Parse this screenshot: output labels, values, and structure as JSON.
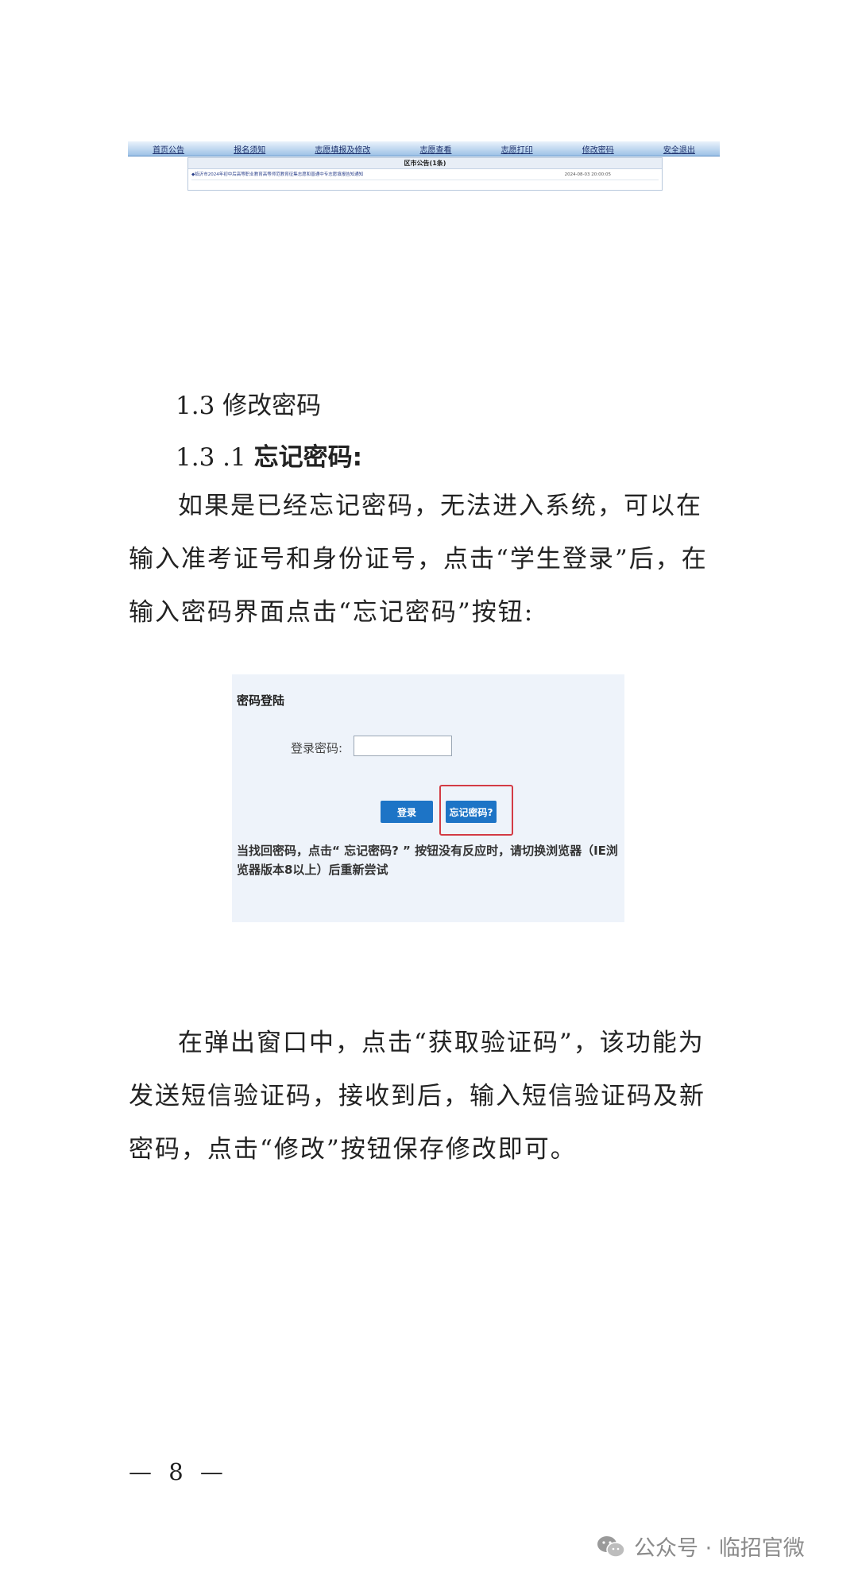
{
  "nav_screenshot": {
    "items": [
      "首页公告",
      "报名须知",
      "志愿填报及修改",
      "志愿查看",
      "志愿打印",
      "修改密码",
      "安全退出"
    ],
    "notice_title": "区市公告(1条)",
    "notice_text": "◆临沂市2024年初中后高等职业教育高等师范教育征集志愿和普通中专志愿填报告知通知",
    "notice_date": "2024-08-03 20:00:05"
  },
  "heading_13": "1.3 修改密码",
  "heading_131_num": "1.3 .1 ",
  "heading_131_title": "忘记密码:",
  "paragraph_1": "如果是已经忘记密码，无法进入系统，可以在输入准考证号和身份证号，点击“学生登录”后，在输入密码界面点击“忘记密码”按钮:",
  "login_screenshot": {
    "title": "密码登陆",
    "password_label": "登录密码:",
    "login_button": "登录",
    "forgot_button": "忘记密码?",
    "tip": "当找回密码，点击“ 忘记密码? ” 按钮没有反应时，请切换浏览器（IE浏览器版本8以上）后重新尝试",
    "highlight_color": "#d33b45",
    "button_color": "#1d74c6"
  },
  "paragraph_2": "在弹出窗口中，点击“获取验证码”，该功能为发送短信验证码，接收到后，输入短信验证码及新密码，点击“修改”按钮保存修改即可。",
  "page_number": "— 8 —",
  "watermark": "公众号 · 临招官微",
  "watermark_icon": "wechat-icon"
}
